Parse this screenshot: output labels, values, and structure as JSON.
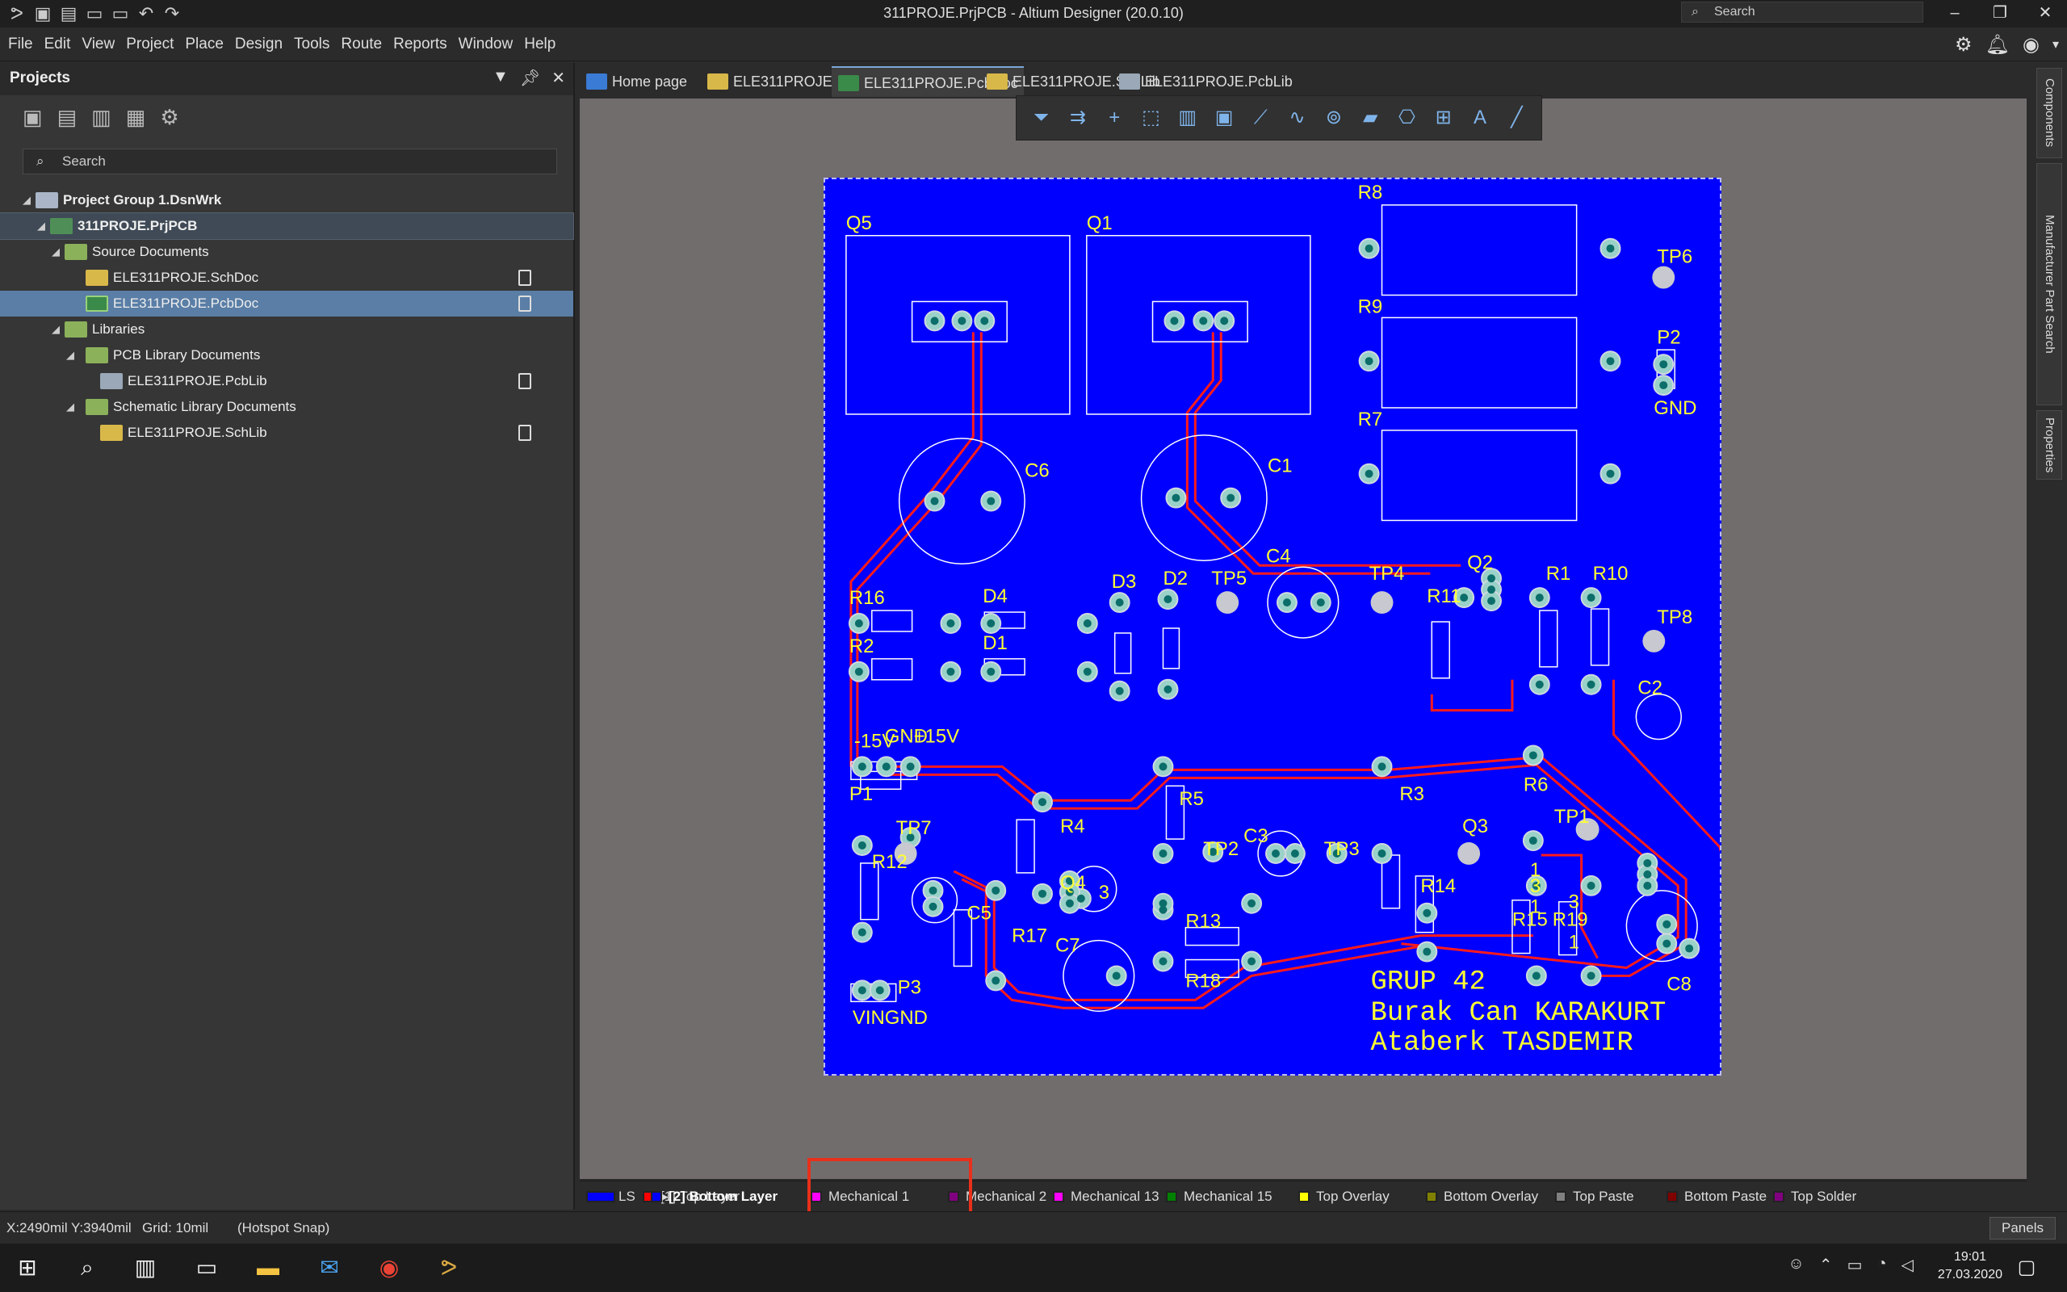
{
  "window": {
    "title": "311PROJE.PrjPCB - Altium Designer (20.0.10)",
    "search_placeholder": "Search"
  },
  "menu": [
    "File",
    "Edit",
    "View",
    "Project",
    "Place",
    "Design",
    "Tools",
    "Route",
    "Reports",
    "Window",
    "Help"
  ],
  "projects_panel": {
    "title": "Projects",
    "search_placeholder": "Search",
    "tree": [
      {
        "label": "Project Group 1.DsnWrk",
        "level": 0,
        "icon": "workspace-icon",
        "bold": true
      },
      {
        "label": "311PROJE.PrjPCB",
        "level": 1,
        "icon": "project-icon",
        "bold": true,
        "focused": true
      },
      {
        "label": "Source Documents",
        "level": 2,
        "icon": "folder-icon"
      },
      {
        "label": "ELE311PROJE.SchDoc",
        "level": 3,
        "icon": "schematic-doc-icon",
        "doc": true
      },
      {
        "label": "ELE311PROJE.PcbDoc",
        "level": 3,
        "icon": "pcb-doc-icon",
        "doc": true,
        "selected": true
      },
      {
        "label": "Libraries",
        "level": 2,
        "icon": "folder-icon"
      },
      {
        "label": "PCB Library Documents",
        "level": 3,
        "icon": "folder-icon"
      },
      {
        "label": "ELE311PROJE.PcbLib",
        "level": 4,
        "icon": "pcb-lib-icon",
        "doc": true
      },
      {
        "label": "Schematic Library Documents",
        "level": 3,
        "icon": "folder-icon"
      },
      {
        "label": "ELE311PROJE.SchLib",
        "level": 4,
        "icon": "sch-lib-icon",
        "doc": true
      }
    ]
  },
  "doc_tabs": [
    {
      "label": "Home page",
      "icon": "home-icon",
      "active": false
    },
    {
      "label": "ELE311PROJE.SchDoc",
      "icon": "schematic-doc-icon",
      "active": false
    },
    {
      "label": "ELE311PROJE.PcbDoc",
      "icon": "pcb-doc-icon",
      "active": true
    },
    {
      "label": "ELE311PROJE.SchLib",
      "icon": "sch-lib-icon",
      "active": false
    },
    {
      "label": "ELE311PROJE.PcbLib",
      "icon": "pcb-lib-icon",
      "active": false
    }
  ],
  "pcb_toolbar": [
    "filter-icon",
    "interactive-route-icon",
    "add-icon",
    "select-rect-icon",
    "chart-icon",
    "component-icon",
    "route-icon",
    "tune-icon",
    "probe-icon",
    "region-icon",
    "via-icon",
    "dimension-icon",
    "text-icon",
    "line-icon"
  ],
  "right_panels": [
    "Components",
    "Manufacturer Part Search",
    "Properties"
  ],
  "board": {
    "designators": [
      "Q5",
      "Q1",
      "R8",
      "TP6",
      "R9",
      "P2",
      "GND",
      "R7",
      "C6",
      "C1",
      "C4",
      "Q2",
      "R1",
      "R10",
      "TP5",
      "TP4",
      "R11",
      "D3",
      "D2",
      "TP8",
      "R16",
      "D4",
      "D1",
      "R2",
      "C2",
      "-15V",
      "GND",
      "+15V",
      "P1",
      "R5",
      "R3",
      "R6",
      "TP1",
      "TP7",
      "R4",
      "C3",
      "TP2",
      "TP3",
      "Q3",
      "R12",
      "Q4",
      "R14",
      "C5",
      "R17",
      "R13",
      "R15",
      "R19",
      "C7",
      "R18",
      "C8",
      "P3",
      "VIN",
      "GND",
      "1",
      "3",
      "1",
      "3",
      "1",
      "3"
    ],
    "signature": [
      "GRUP  42",
      "Burak  Can  KARAKURT",
      "Ataberk  TASDEMIR"
    ],
    "color": "#0000ff",
    "trace_color": "#ff1a1a",
    "text_color": "#ffff33"
  },
  "layers": [
    {
      "label": "LS",
      "color": "#0000ff"
    },
    {
      "label": "[1] Top Layer",
      "color": "#ff0000"
    },
    {
      "label": "[2] Bottom Layer",
      "color": "#0000ff",
      "active": true
    },
    {
      "label": "Mechanical 1",
      "color": "#ff00ff"
    },
    {
      "label": "Mechanical 2",
      "color": "#800080"
    },
    {
      "label": "Mechanical 13",
      "color": "#ff00ff"
    },
    {
      "label": "Mechanical 15",
      "color": "#008000"
    },
    {
      "label": "Top Overlay",
      "color": "#ffff00"
    },
    {
      "label": "Bottom Overlay",
      "color": "#808000"
    },
    {
      "label": "Top Paste",
      "color": "#808080"
    },
    {
      "label": "Bottom Paste",
      "color": "#800000"
    },
    {
      "label": "Top Solder",
      "color": "#800080"
    }
  ],
  "status": {
    "coords": "X:2490mil Y:3940mil",
    "grid": "Grid: 10mil",
    "snap": "(Hotspot Snap)",
    "panels": "Panels"
  },
  "taskbar": {
    "time": "19:01",
    "date": "27.03.2020"
  }
}
